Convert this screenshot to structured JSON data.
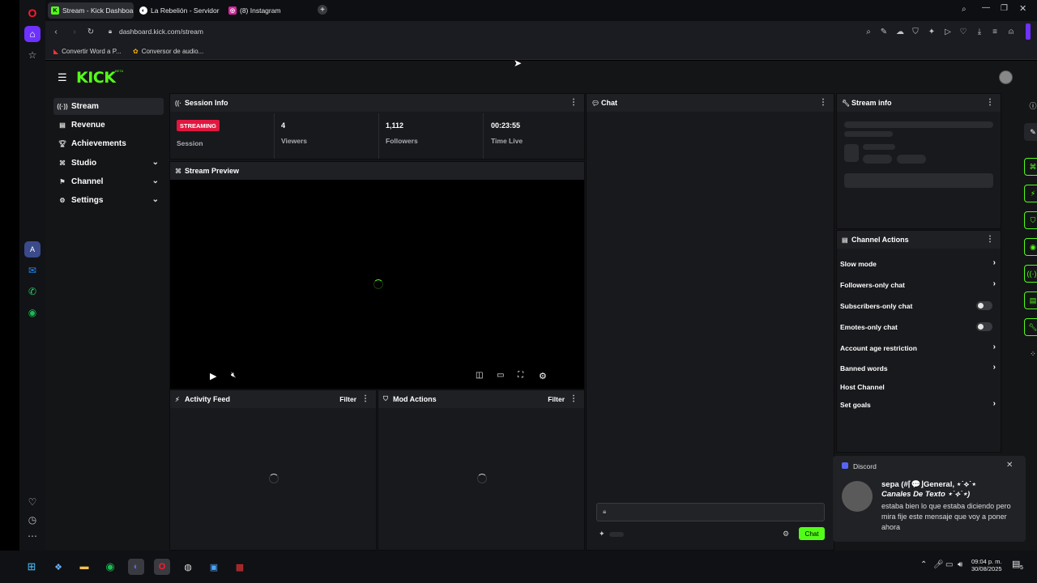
{
  "browser": {
    "tabs": [
      {
        "label": "Stream - Kick Dashboard",
        "active": true
      },
      {
        "label": "La Rebelión - Servidor de",
        "active": false
      },
      {
        "label": "(8) Instagram",
        "active": false
      }
    ],
    "address": "dashboard.kick.com/stream",
    "bookmarks": [
      "Convertir Word a P...",
      "Conversor de audio..."
    ]
  },
  "kick": {
    "logo": "KICK",
    "logo_badge": "BETA",
    "nav": [
      {
        "label": "Stream",
        "icon": "stream-icon",
        "active": true
      },
      {
        "label": "Revenue",
        "icon": "revenue-icon"
      },
      {
        "label": "Achievements",
        "icon": "trophy-icon"
      },
      {
        "label": "Studio",
        "icon": "studio-icon",
        "expandable": true
      },
      {
        "label": "Channel",
        "icon": "channel-icon",
        "expandable": true
      },
      {
        "label": "Settings",
        "icon": "gear-icon",
        "expandable": true
      }
    ],
    "session_info": {
      "title": "Session Info",
      "status_badge": "STREAMING",
      "session_label": "Session",
      "stats": [
        {
          "value": "4",
          "label": "Viewers"
        },
        {
          "value": "1,112",
          "label": "Followers"
        },
        {
          "value": "00:23:55",
          "label": "Time Live"
        }
      ]
    },
    "stream_preview": {
      "title": "Stream Preview"
    },
    "activity_feed": {
      "title": "Activity Feed",
      "filter": "Filter"
    },
    "mod_actions": {
      "title": "Mod Actions",
      "filter": "Filter"
    },
    "chat": {
      "title": "Chat",
      "send_label": "Chat"
    },
    "stream_info": {
      "title": "Stream info"
    },
    "channel_actions": {
      "title": "Channel Actions",
      "items": [
        {
          "label": "Slow mode",
          "control": "arrow"
        },
        {
          "label": "Followers-only chat",
          "control": "arrow"
        },
        {
          "label": "Subscribers-only chat",
          "control": "toggle",
          "enabled": false
        },
        {
          "label": "Emotes-only chat",
          "control": "toggle",
          "enabled": false
        },
        {
          "label": "Account age restriction",
          "control": "arrow"
        },
        {
          "label": "Banned words",
          "control": "arrow"
        },
        {
          "label": "Host Channel",
          "control": "none"
        },
        {
          "label": "Set goals",
          "control": "arrow"
        }
      ]
    },
    "accent_color": "#53fc18",
    "badge_color": "#e0173f"
  },
  "discord_toast": {
    "app": "Discord",
    "user": "sepa (#⌈💬⌋General, ⋆˙⟡˙⋆",
    "channel": "Canales De Texto ⋆˙⟡˙⋆)",
    "message": "estaba bien lo que estaba diciendo pero mira fije este mensaje que voy a poner ahora"
  },
  "taskbar": {
    "time": "09:04 p. m.",
    "date": "30/08/2025",
    "notification_count": "5"
  }
}
